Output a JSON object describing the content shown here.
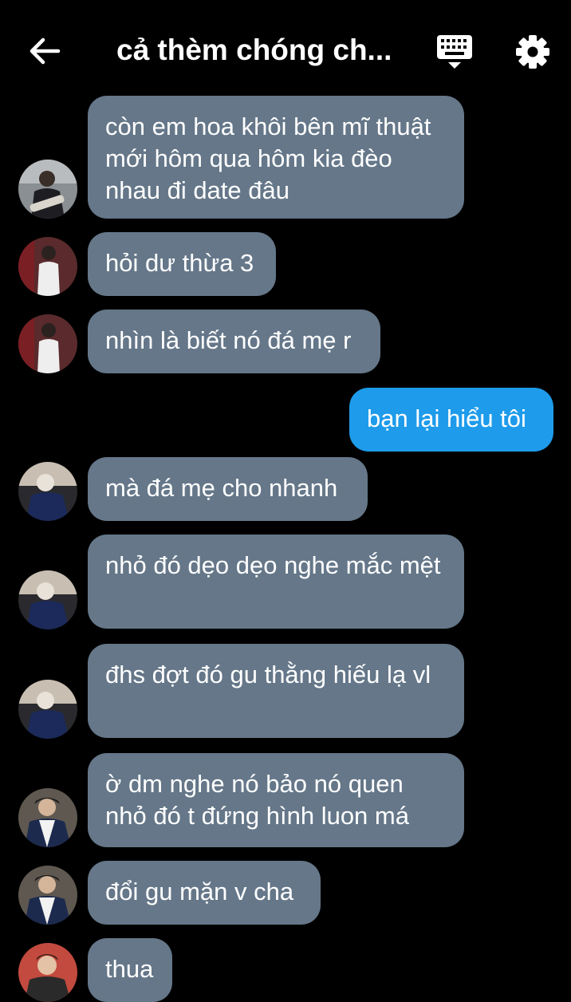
{
  "header": {
    "title": "cả thèm chóng ch...",
    "back_icon": "arrow-left-icon",
    "keyboard_icon": "keyboard-icon",
    "settings_icon": "gear-icon"
  },
  "messages": [
    {
      "sender": "other",
      "text": "còn em hoa khôi bên mĩ thuật mới hôm qua hôm kia đèo nhau đi date đâu"
    },
    {
      "sender": "other",
      "text": "hỏi dư thừa 3"
    },
    {
      "sender": "other",
      "text": "nhìn là biết nó đá mẹ r"
    },
    {
      "sender": "self",
      "text": "bạn lại hiểu tôi"
    },
    {
      "sender": "other",
      "text": "mà đá mẹ cho nhanh"
    },
    {
      "sender": "other",
      "text": "nhỏ đó dẹo dẹo nghe mắc mệt"
    },
    {
      "sender": "other",
      "text": "đhs đợt đó gu thằng hiếu lạ vl"
    },
    {
      "sender": "other",
      "text": "ờ dm nghe nó bảo nó quen nhỏ đó t đứng hình luon má"
    },
    {
      "sender": "other",
      "text": "đổi gu mặn v cha"
    },
    {
      "sender": "other",
      "text": "thua"
    }
  ],
  "colors": {
    "background": "#000000",
    "incoming_bubble": "#657789",
    "outgoing_bubble": "#1e9bea"
  }
}
